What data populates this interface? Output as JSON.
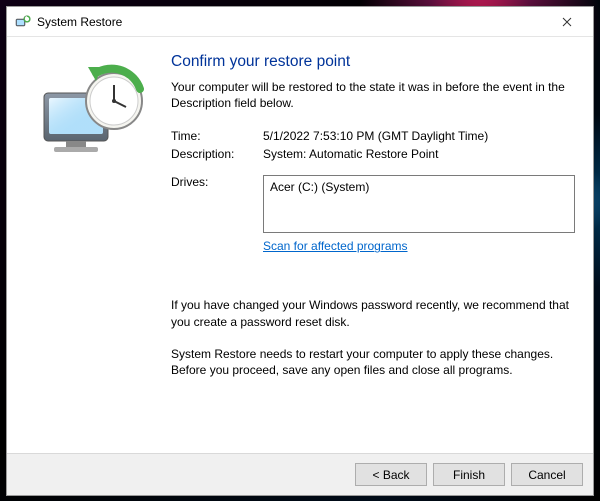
{
  "window": {
    "title": "System Restore"
  },
  "main": {
    "heading": "Confirm your restore point",
    "subtext": "Your computer will be restored to the state it was in before the event in the Description field below.",
    "time_label": "Time:",
    "time_value": "5/1/2022 7:53:10 PM (GMT Daylight Time)",
    "description_label": "Description:",
    "description_value": "System: Automatic Restore Point",
    "drives_label": "Drives:",
    "drives_value": "Acer (C:) (System)",
    "scan_link": "Scan for affected programs",
    "password_note": "If you have changed your Windows password recently, we recommend that you create a password reset disk.",
    "restart_note": "System Restore needs to restart your computer to apply these changes. Before you proceed, save any open files and close all programs."
  },
  "footer": {
    "back": "< Back",
    "finish": "Finish",
    "cancel": "Cancel"
  }
}
